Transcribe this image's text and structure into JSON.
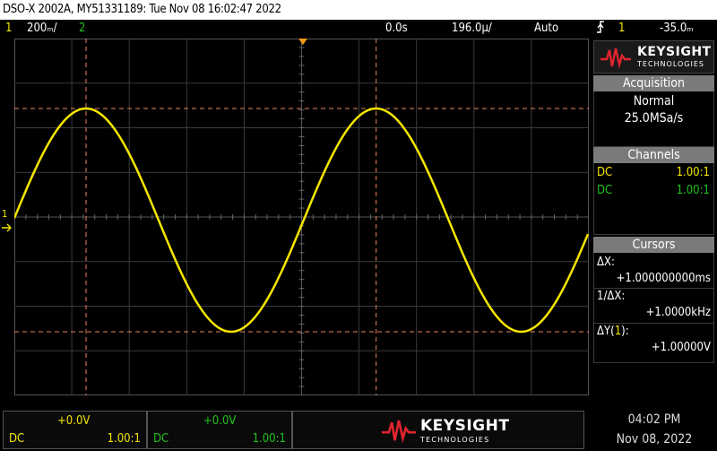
{
  "titlebar": {
    "text": "DSO-X 2002A, MY51331189: Tue Nov 08 16:02:47 2022"
  },
  "status": {
    "ch1_label": "1",
    "ch1_scale": "200ₘ/",
    "ch2_label": "2",
    "time_ref": "0.0s",
    "time_scale": "196.0µ/",
    "trigger_mode": "Auto",
    "trigger_icon": "trigger-edge-icon",
    "trigger_channel": "1",
    "trigger_level": "-35.0ₘ"
  },
  "colors": {
    "ch1": "#f5e600",
    "ch2": "#21c21c",
    "cursor": "#e8865a",
    "grid": "#3b3b3b",
    "logo_red": "#e0242f"
  },
  "logo": {
    "brand": "KEYSIGHT",
    "sub": "TECHNOLOGIES"
  },
  "acquisition": {
    "title": "Acquisition",
    "mode": "Normal",
    "rate": "25.0MSa/s"
  },
  "channels": {
    "title": "Channels",
    "items": [
      {
        "coupling": "DC",
        "probe": "1.00:1"
      },
      {
        "coupling": "DC",
        "probe": "1.00:1"
      }
    ]
  },
  "cursors": {
    "title": "Cursors",
    "dx_label": "ΔX:",
    "dx_value": "+1.000000000ms",
    "inv_dx_label": "1/ΔX:",
    "inv_dx_value": "+1.0000kHz",
    "dy_label": "ΔY(1):",
    "dy_value": "+1.00000V"
  },
  "bottom": {
    "ch1": {
      "offset": "+0.0V",
      "coupling": "DC",
      "probe": "1.00:1"
    },
    "ch2": {
      "offset": "+0.0V",
      "coupling": "DC",
      "probe": "1.00:1"
    },
    "clock_time": "04:02 PM",
    "clock_date": "Nov 08, 2022"
  },
  "markers": {
    "ch1_ground": "1",
    "trigger_arrow": "T"
  }
}
